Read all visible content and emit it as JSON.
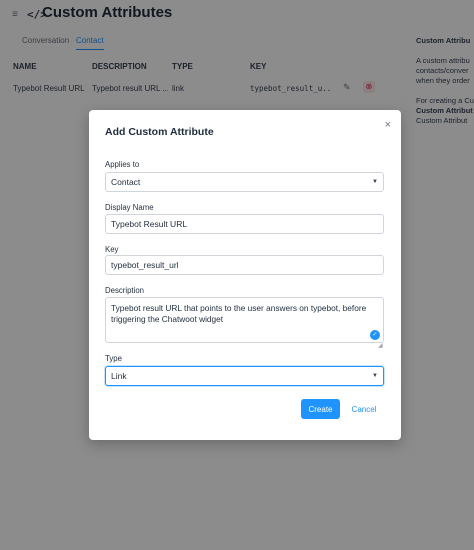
{
  "header": {
    "menu_icon": "≡",
    "code_icon": "</>",
    "title": "Custom Attributes"
  },
  "tabs": [
    {
      "label": "Conversation",
      "active": false
    },
    {
      "label": "Contact",
      "active": true
    }
  ],
  "table": {
    "columns": [
      "NAME",
      "DESCRIPTION",
      "TYPE",
      "KEY"
    ],
    "rows": [
      {
        "name": "Typebot Result URL",
        "description": "Typebot result URL ...",
        "type": "link",
        "key": "typebot_result_u..."
      }
    ]
  },
  "side_panel": {
    "lines": [
      {
        "text": "Custom Attribu",
        "bold": true
      },
      {
        "text": "",
        "bold": false
      },
      {
        "text": "A custom attribu",
        "bold": false
      },
      {
        "text": "contacts/conver",
        "bold": false
      },
      {
        "text": "when they order",
        "bold": false
      },
      {
        "text": "",
        "bold": false
      },
      {
        "text": "For creating a Cu",
        "bold": false
      },
      {
        "text": "Custom Attribut",
        "bold": true
      },
      {
        "text": "Custom Attribut",
        "bold": false
      }
    ]
  },
  "modal": {
    "title": "Add Custom Attribute",
    "close_icon": "×",
    "applies_to": {
      "label": "Applies to",
      "value": "Contact"
    },
    "display_name": {
      "label": "Display Name",
      "value": "Typebot Result URL"
    },
    "key": {
      "label": "Key",
      "value": "typebot_result_url"
    },
    "description": {
      "label": "Description",
      "value": "Typebot result URL that points to the user answers on typebot, before triggering the Chatwoot widget"
    },
    "type": {
      "label": "Type",
      "value": "Link"
    },
    "create_label": "Create",
    "cancel_label": "Cancel"
  },
  "colors": {
    "accent": "#1f93ff",
    "danger": "#e0245e",
    "overlay": "rgba(0,0,0,0.45)"
  }
}
